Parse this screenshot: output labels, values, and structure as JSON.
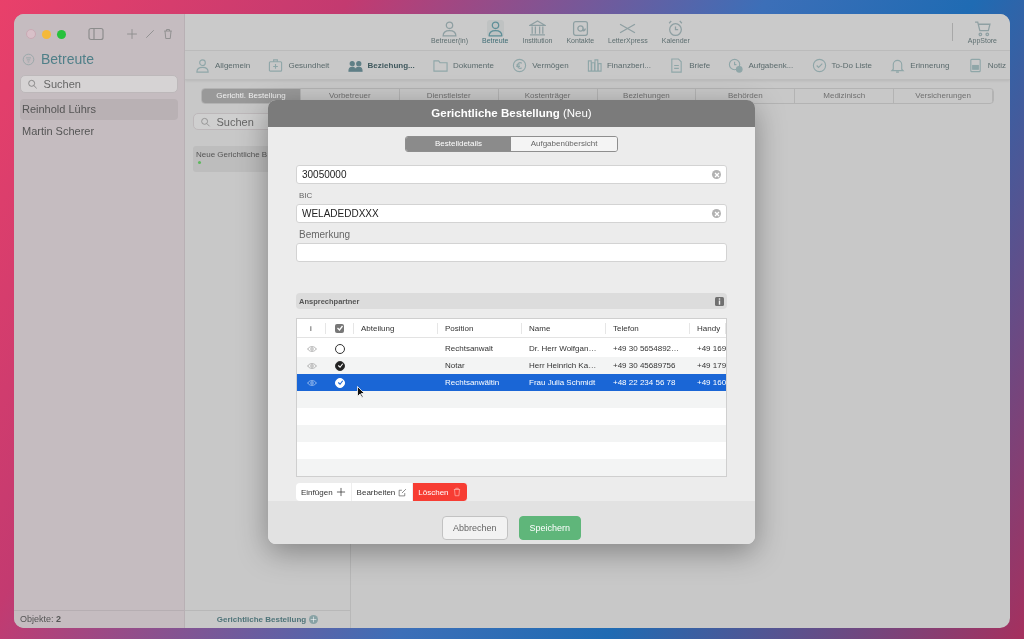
{
  "sidebar": {
    "title": "Betreute",
    "search": {
      "placeholder": "Suchen"
    },
    "items": [
      {
        "label": "Reinhold Lührs",
        "selected": true
      },
      {
        "label": "Martin Scherer",
        "selected": false
      }
    ],
    "status": "Objekte: **2**"
  },
  "toolbar": {
    "items": [
      {
        "label": "Betreuer(in)",
        "selected": false
      },
      {
        "label": "Betreute",
        "selected": true
      },
      {
        "label": "Institution",
        "selected": false
      },
      {
        "label": "Kontakte",
        "selected": false
      },
      {
        "label": "LetterXpress",
        "selected": false
      },
      {
        "label": "Kalender",
        "selected": false
      }
    ],
    "store": "AppStore"
  },
  "sections": [
    {
      "label": "Allgemein",
      "selected": false
    },
    {
      "label": "Gesundheit",
      "selected": false
    },
    {
      "label": "Beziehung...",
      "selected": true
    },
    {
      "label": "Dokumente",
      "selected": false
    },
    {
      "label": "Vermögen",
      "selected": false
    },
    {
      "label": "Finanzberi...",
      "selected": false
    },
    {
      "label": "Briefe",
      "selected": false
    },
    {
      "label": "Aufgabenk...",
      "selected": false
    },
    {
      "label": "To-Do Liste",
      "selected": false
    },
    {
      "label": "Erinnerung",
      "selected": false
    },
    {
      "label": "Notiz",
      "selected": false
    }
  ],
  "tabs": [
    {
      "label": "Gerichtl. Bestellung",
      "selected": true
    },
    {
      "label": "Vorbetreuer",
      "selected": false
    },
    {
      "label": "Dienstleister",
      "selected": false
    },
    {
      "label": "Kostenträger",
      "selected": false
    },
    {
      "label": "Beziehungen",
      "selected": false
    },
    {
      "label": "Behörden",
      "selected": false
    },
    {
      "label": "Medizinisch",
      "selected": false
    },
    {
      "label": "Versicherungen",
      "selected": false
    }
  ],
  "list": {
    "search": {
      "placeholder": "Suchen"
    },
    "items": [
      {
        "label": "Neue Gerichtliche B",
        "color": "#5cb85c"
      }
    ],
    "footer": "Gerichtliche Bestellung"
  },
  "dialog": {
    "title": "**Gerichtliche Bestellung** (Neu)",
    "segments": [
      {
        "label": "Bestelldetails",
        "selected": true
      },
      {
        "label": "Aufgabenübersicht",
        "selected": false
      }
    ],
    "fields": [
      {
        "value": "30050000",
        "clearable": true
      },
      {
        "label": "BIC",
        "value": "WELADEDDXXX",
        "clearable": true
      },
      {
        "label": "Bemerkung"
      }
    ],
    "contacts": {
      "title": "Ansprechpartner",
      "header_checked": true,
      "columns": [
        "i",
        "Abteilung",
        "Position",
        "Name",
        "Telefon",
        "Handy"
      ],
      "rows": [
        {
          "checked": false,
          "selected": false,
          "position": "Rechtsanwalt",
          "name": "Dr. Herr Wolfgan…",
          "phone": "+49 30 5654892…",
          "mobile": "+49 169"
        },
        {
          "checked": true,
          "selected": false,
          "position": "Notar",
          "name": "Herr Heinrich Ka…",
          "phone": "+49 30 45689756",
          "mobile": "+49 179"
        },
        {
          "checked": true,
          "selected": true,
          "position": "Rechtsanwältin",
          "name": "Frau Julia Schmidt",
          "phone": "+48 22 234 56 78",
          "mobile": "+49 160"
        }
      ],
      "actions": [
        {
          "label": "Einfügen",
          "kind": "add"
        },
        {
          "label": "Bearbeiten",
          "kind": "edit"
        },
        {
          "label": "Löschen",
          "kind": "delete"
        }
      ]
    },
    "buttons": [
      {
        "label": "Abbrechen",
        "kind": "cancel"
      },
      {
        "label": "Speichern",
        "kind": "primary"
      }
    ]
  }
}
